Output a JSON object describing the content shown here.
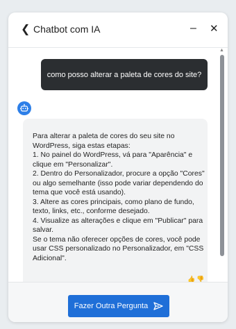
{
  "header": {
    "back_icon": "chevron-left-icon",
    "title": "Chatbot com IA",
    "minimize_icon": "minimize-icon",
    "close_icon": "close-icon"
  },
  "conversation": {
    "user_message": "como posso alterar a paleta de cores do site?",
    "bot_avatar_icon": "robot-icon",
    "bot_message": "Para alterar a paleta de cores do seu site no WordPress, siga estas etapas:\n1. No painel do WordPress, vá para \"Aparência\" e clique em \"Personalizar\".\n2. Dentro do Personalizador, procure a opção \"Cores\" ou algo semelhante (isso pode variar dependendo do tema que você está usando).\n3. Altere as cores principais, como plano de fundo, texto, links, etc., conforme desejado.\n4. Visualize as alterações e clique em \"Publicar\" para salvar.\nSe o tema não oferecer opções de cores, você pode usar CSS personalizado no Personalizador, em \"CSS Adicional\"."
  },
  "footer": {
    "button_label": "Fazer Outra Pergunta",
    "button_icon": "send-icon"
  },
  "colors": {
    "accent": "#1f6fd8",
    "user_bubble": "#2b2e31",
    "bot_bubble": "#f2f3f4"
  }
}
